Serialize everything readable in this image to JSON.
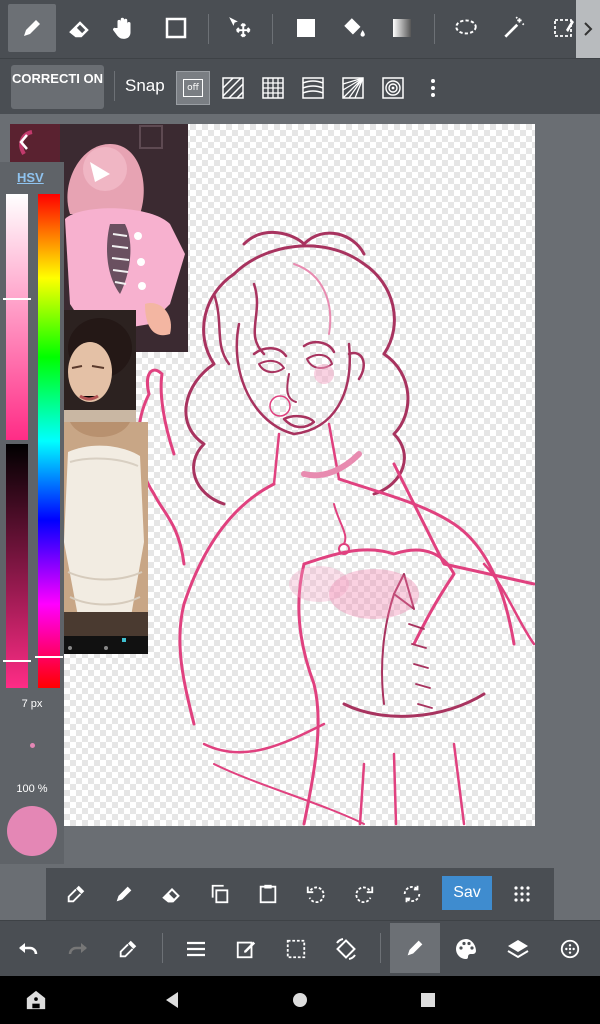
{
  "sub_toolbar": {
    "correction_label": "CORRECTI ON",
    "snap_label": "Snap",
    "snap_off_label": "off"
  },
  "color_panel": {
    "mode_tab": "HSV",
    "brush_size": "7 px",
    "opacity": "100 %",
    "current_color": "#e487b5"
  },
  "bottom_toolbar": {
    "save_label": "Sav"
  },
  "colors": {
    "toolbar_bg": "#4a4e53",
    "canvas_bg": "#6a6e73",
    "accent": "#3f8ccf",
    "sketch_pink": "#e0417f",
    "sketch_dark": "#a8335f"
  }
}
